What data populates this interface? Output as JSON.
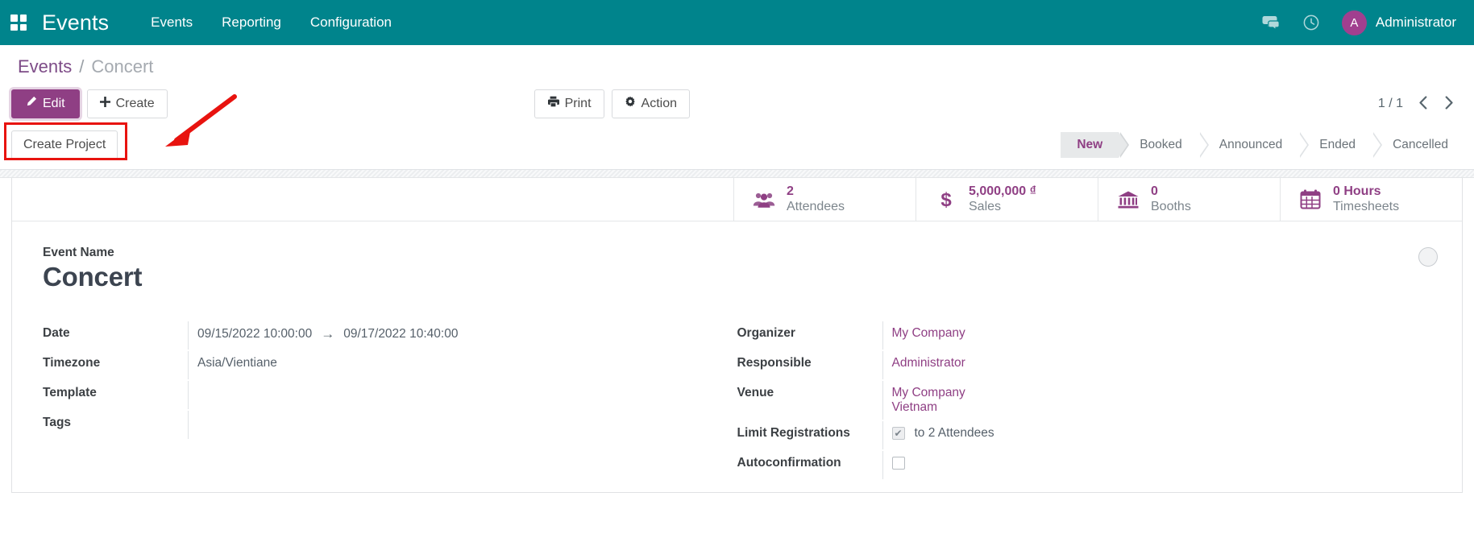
{
  "navbar": {
    "apps_icon": "apps-grid-icon",
    "brand": "Events",
    "menu": [
      "Events",
      "Reporting",
      "Configuration"
    ],
    "messages_icon": "chat-bubble-icon",
    "activities_icon": "clock-icon",
    "user_initial": "A",
    "user_name": "Administrator",
    "brand_color": "#00848c",
    "accent_color": "#8f3f84"
  },
  "breadcrumb": {
    "root": "Events",
    "separator": "/",
    "current": "Concert"
  },
  "toolbar": {
    "edit_label": "Edit",
    "edit_icon": "pencil-icon",
    "create_label": "Create",
    "create_icon": "plus-icon",
    "print_label": "Print",
    "print_icon": "printer-icon",
    "action_label": "Action",
    "action_icon": "gear-icon",
    "pager_value": "1 / 1",
    "pager_prev_icon": "chevron-left-icon",
    "pager_next_icon": "chevron-right-icon"
  },
  "action_bar": {
    "create_project_label": "Create Project",
    "highlight_color": "#e8130f"
  },
  "statusbar": {
    "stages": [
      "New",
      "Booked",
      "Announced",
      "Ended",
      "Cancelled"
    ],
    "active": "New"
  },
  "smart_buttons": [
    {
      "icon": "users-icon",
      "value": "2",
      "label": "Attendees"
    },
    {
      "icon": "dollar-icon",
      "value": "5,000,000 ₫",
      "label": "Sales"
    },
    {
      "icon": "bank-icon",
      "value": "0",
      "label": "Booths"
    },
    {
      "icon": "calendar-icon",
      "value": "0 Hours",
      "label": "Timesheets"
    }
  ],
  "form": {
    "name_label": "Event Name",
    "name_value": "Concert",
    "left": {
      "date_label": "Date",
      "date_start": "09/15/2022 10:00:00",
      "date_arrow": "→",
      "date_end": "09/17/2022 10:40:00",
      "timezone_label": "Timezone",
      "timezone_value": "Asia/Vientiane",
      "template_label": "Template",
      "template_value": "",
      "tags_label": "Tags",
      "tags_value": ""
    },
    "right": {
      "organizer_label": "Organizer",
      "organizer_value": "My Company",
      "responsible_label": "Responsible",
      "responsible_value": "Administrator",
      "venue_label": "Venue",
      "venue_value_line1": "My Company",
      "venue_value_line2": "Vietnam",
      "limit_label": "Limit Registrations",
      "limit_checked": true,
      "limit_text": "to 2 Attendees",
      "autoconfirm_label": "Autoconfirmation",
      "autoconfirm_checked": false,
      "check_glyph": "✔"
    }
  }
}
